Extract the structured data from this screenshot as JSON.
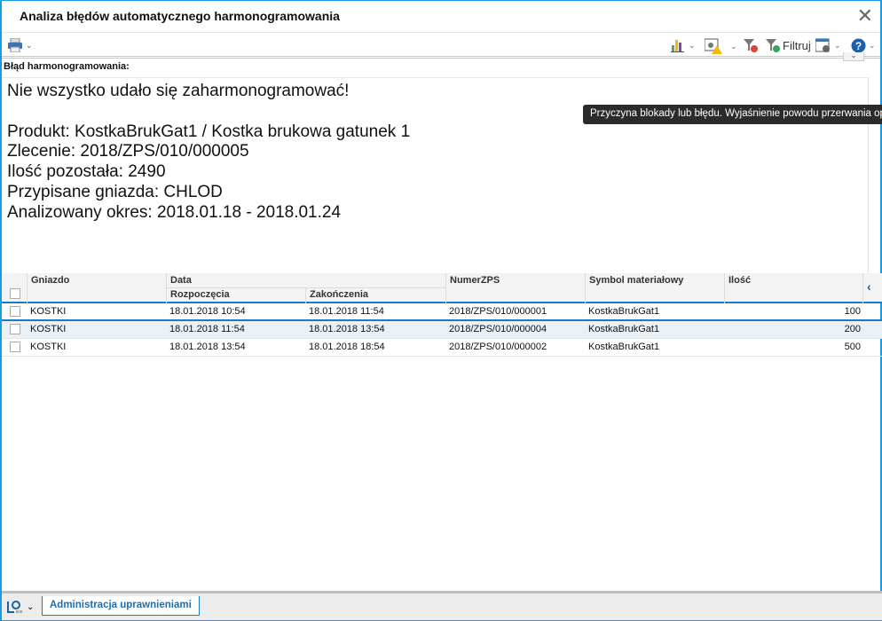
{
  "window": {
    "title": "Analiza błędów automatycznego harmonogramowania",
    "close_icon": "close-icon"
  },
  "toolbar": {
    "print_icon": "printer-icon",
    "chart_icon": "bar-chart-icon",
    "settings_warning_icon": "settings-warning-icon",
    "clear_filter_icon": "filter-clear-icon",
    "filter_label": "Filtruj",
    "layout_icon": "layout-settings-icon",
    "help_icon": "help-icon"
  },
  "error": {
    "label": "Błąd harmonogramowania:",
    "lines": [
      "Nie wszystko udało się zaharmonogramować!",
      "",
      "Produkt: KostkaBrukGat1 / Kostka brukowa gatunek 1",
      "Zlecenie: 2018/ZPS/010/000005",
      "Ilość pozostała: 2490",
      "Przypisane gniazda: CHLOD",
      "Analizowany okres: 2018.01.18 - 2018.01.24"
    ]
  },
  "tooltip": "Przyczyna blokady lub błędu. Wyjaśnienie powodu przerwania operacji",
  "grid": {
    "headers": {
      "gniazdo": "Gniazdo",
      "data": "Data",
      "rozpoczecia": "Rozpoczęcia",
      "zakonczenia": "Zakończenia",
      "numer": "NumerZPS",
      "symbol": "Symbol materiałowy",
      "ilosc": "Ilość"
    },
    "rows": [
      {
        "gniazdo": "KOSTKI",
        "start": "18.01.2018 10:54",
        "end": "18.01.2018 11:54",
        "numer": "2018/ZPS/010/000001",
        "symbol": "KostkaBrukGat1",
        "ilosc": "100"
      },
      {
        "gniazdo": "KOSTKI",
        "start": "18.01.2018 11:54",
        "end": "18.01.2018 13:54",
        "numer": "2018/ZPS/010/000004",
        "symbol": "KostkaBrukGat1",
        "ilosc": "200"
      },
      {
        "gniazdo": "KOSTKI",
        "start": "18.01.2018 13:54",
        "end": "18.01.2018 18:54",
        "numer": "2018/ZPS/010/000002",
        "symbol": "KostkaBrukGat1",
        "ilosc": "500"
      }
    ]
  },
  "footer": {
    "admin_button": "Administracja uprawnieniami"
  },
  "colors": {
    "accent": "#1a7bc4",
    "border": "#1a9be0"
  }
}
